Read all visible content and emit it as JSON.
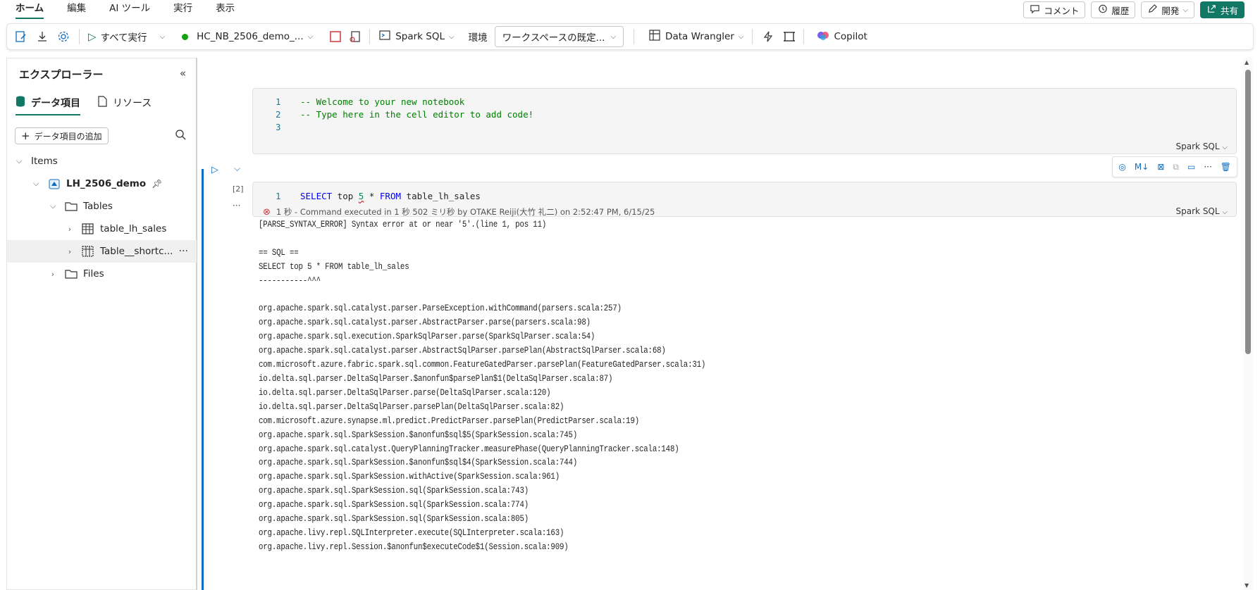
{
  "menu": {
    "tabs": [
      "ホーム",
      "編集",
      "AI ツール",
      "実行",
      "表示"
    ],
    "comment": "コメント",
    "history": "履歴",
    "develop": "開発",
    "share": "共有"
  },
  "toolbar": {
    "run_all": "すべて実行",
    "session": "HC_NB_2506_demo_...",
    "language": "Spark SQL",
    "env_label": "環境",
    "env_value": "ワークスペースの既定...",
    "data_wrangler": "Data Wrangler",
    "copilot": "Copilot"
  },
  "explorer": {
    "title": "エクスプローラー",
    "tab_data": "データ項目",
    "tab_resources": "リソース",
    "add_button": "データ項目の追加",
    "tree": {
      "items": "Items",
      "lakehouse": "LH_2506_demo",
      "tables": "Tables",
      "table1": "table_lh_sales",
      "table2": "Table__shortc...",
      "files": "Files"
    }
  },
  "cell1": {
    "lines": [
      {
        "num": "1",
        "text": "-- Welcome to your new notebook"
      },
      {
        "num": "2",
        "text": "-- Type here in the cell editor to add code!"
      },
      {
        "num": "3",
        "text": ""
      }
    ],
    "lang": "Spark SQL"
  },
  "cell2": {
    "exec_count": "[2]",
    "line_num": "1",
    "code_kw1": "SELECT",
    "code_mid1": " top ",
    "code_num": "5",
    "code_mid2": " * ",
    "code_kw2": "FROM",
    "code_tail": " table_lh_sales",
    "status": "1 秒 - Command executed in 1 秒 502 ミリ秒 by OTAKE Reiji(大竹 礼二) on 2:52:47 PM, 6/15/25",
    "lang": "Spark SQL",
    "tools": [
      "M↓"
    ],
    "output": "[PARSE_SYNTAX_ERROR] Syntax error at or near '5'.(line 1, pos 11)\n\n== SQL ==\nSELECT top 5 * FROM table_lh_sales\n-----------^^^\n\norg.apache.spark.sql.catalyst.parser.ParseException.withCommand(parsers.scala:257)\norg.apache.spark.sql.catalyst.parser.AbstractParser.parse(parsers.scala:98)\norg.apache.spark.sql.execution.SparkSqlParser.parse(SparkSqlParser.scala:54)\norg.apache.spark.sql.catalyst.parser.AbstractSqlParser.parsePlan(AbstractSqlParser.scala:68)\ncom.microsoft.azure.fabric.spark.sql.common.FeatureGatedParser.parsePlan(FeatureGatedParser.scala:31)\nio.delta.sql.parser.DeltaSqlParser.$anonfun$parsePlan$1(DeltaSqlParser.scala:87)\nio.delta.sql.parser.DeltaSqlParser.parse(DeltaSqlParser.scala:120)\nio.delta.sql.parser.DeltaSqlParser.parsePlan(DeltaSqlParser.scala:82)\ncom.microsoft.azure.synapse.ml.predict.PredictParser.parsePlan(PredictParser.scala:19)\norg.apache.spark.sql.SparkSession.$anonfun$sql$5(SparkSession.scala:745)\norg.apache.spark.sql.catalyst.QueryPlanningTracker.measurePhase(QueryPlanningTracker.scala:148)\norg.apache.spark.sql.SparkSession.$anonfun$sql$4(SparkSession.scala:744)\norg.apache.spark.sql.SparkSession.withActive(SparkSession.scala:961)\norg.apache.spark.sql.SparkSession.sql(SparkSession.scala:743)\norg.apache.spark.sql.SparkSession.sql(SparkSession.scala:774)\norg.apache.spark.sql.SparkSession.sql(SparkSession.scala:805)\norg.apache.livy.repl.SQLInterpreter.execute(SQLInterpreter.scala:163)\norg.apache.livy.repl.Session.$anonfun$executeCode$1(Session.scala:909)"
  },
  "colors": {
    "accent": "#117865",
    "active": "#0f6cbd",
    "error": "#d13438"
  }
}
